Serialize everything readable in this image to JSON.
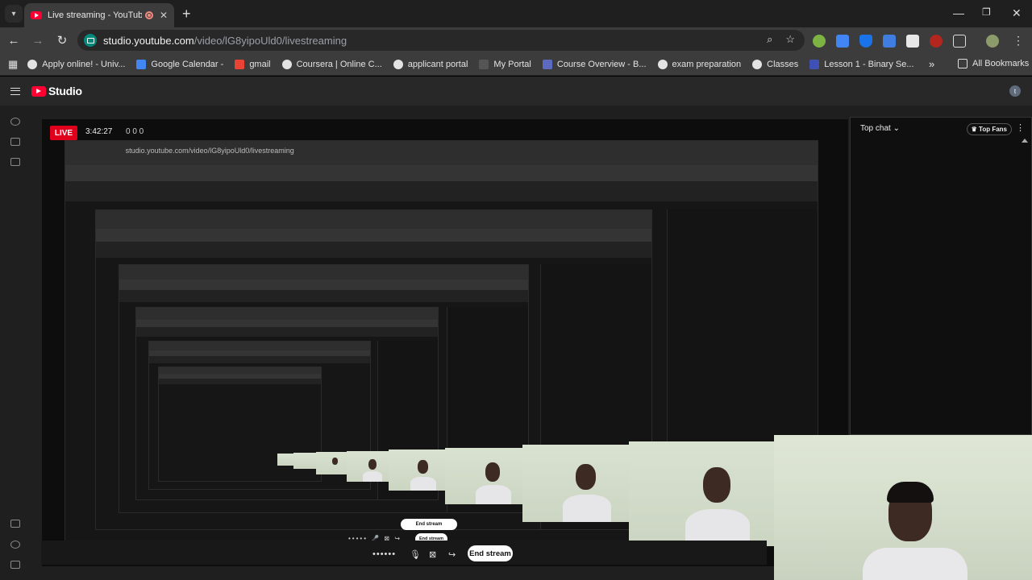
{
  "browser": {
    "tab_title": "Live streaming - YouTube St",
    "url_host": "studio.youtube.com",
    "url_path": "/video/lG8yipoUld0/livestreaming",
    "bookmarks": [
      "Apply online! - Univ...",
      "Google Calendar -",
      "gmail",
      "Coursera | Online C...",
      "applicant portal",
      "My Portal",
      "Course Overview - B...",
      "exam preparation",
      "Classes",
      "Lesson 1 - Binary Se..."
    ],
    "all_bookmarks": "All Bookmarks",
    "more_bookmarks": "»",
    "avatar_letter": "t"
  },
  "studio": {
    "logo_text": "Studio",
    "live_label": "LIVE",
    "live_time": "3:42:27",
    "live_stats": "0    0    0",
    "chat_title": "Top chat",
    "top_fans": "Top Fans",
    "end_stream": "End stream"
  },
  "nested": {
    "url": "studio.youtube.com/video/lG8yipoUld0/livestreaming",
    "end_stream": "End stream"
  },
  "colors": {
    "live_red": "#e0001c",
    "youtube_red": "#ff0033",
    "background": "#1f1f1f"
  }
}
